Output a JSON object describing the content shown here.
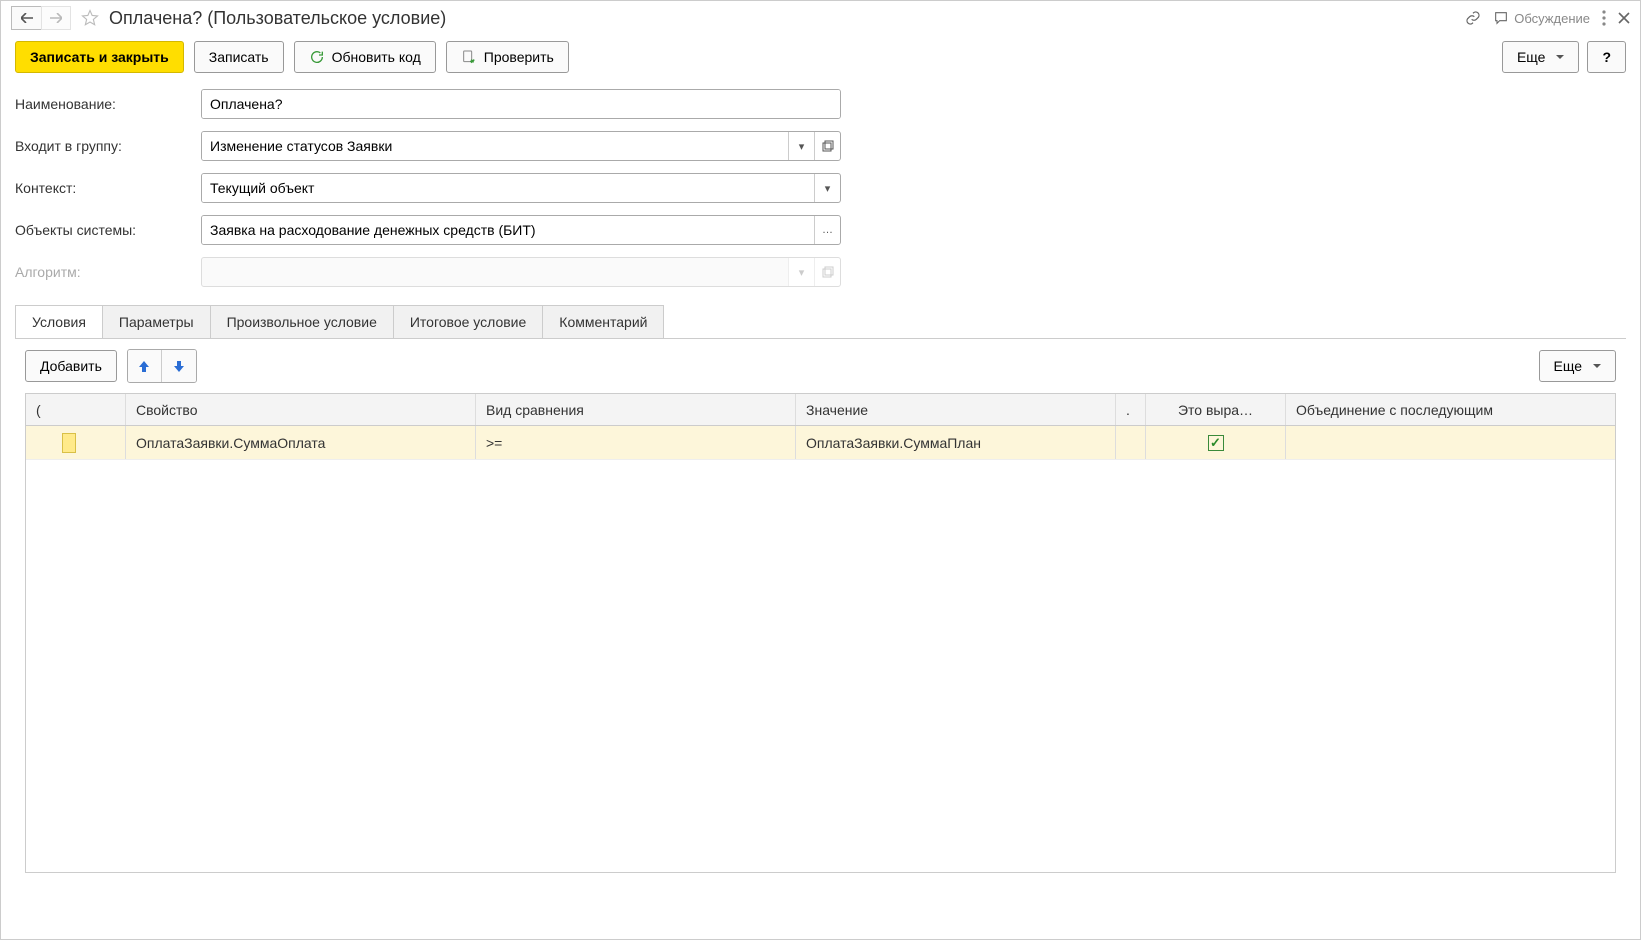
{
  "titlebar": {
    "title": "Оплачена? (Пользовательское условие)",
    "discuss_label": "Обсуждение"
  },
  "toolbar": {
    "save_close": "Записать и закрыть",
    "save": "Записать",
    "refresh_code": "Обновить код",
    "check": "Проверить",
    "more": "Еще",
    "help": "?"
  },
  "form": {
    "name_label": "Наименование:",
    "name_value": "Оплачена?",
    "group_label": "Входит в группу:",
    "group_value": "Изменение статусов Заявки",
    "context_label": "Контекст:",
    "context_value": "Текущий объект",
    "objects_label": "Объекты системы:",
    "objects_value": "Заявка на расходование денежных средств (БИТ)",
    "algorithm_label": "Алгоритм:",
    "algorithm_value": ""
  },
  "tabs": {
    "t0": "Условия",
    "t1": "Параметры",
    "t2": "Произвольное условие",
    "t3": "Итоговое условие",
    "t4": "Комментарий"
  },
  "subtoolbar": {
    "add": "Добавить",
    "more": "Еще"
  },
  "grid": {
    "headers": {
      "h0": "(",
      "h1": "Свойство",
      "h2": "Вид сравнения",
      "h3": "Значение",
      "h4": ".",
      "h5": "Это выра…",
      "h6": "Объединение с последующим"
    },
    "rows": [
      {
        "property": "ОплатаЗаявки.СуммаОплата",
        "compare": ">=",
        "value": "ОплатаЗаявки.СуммаПлан",
        "is_expr": true
      }
    ]
  }
}
